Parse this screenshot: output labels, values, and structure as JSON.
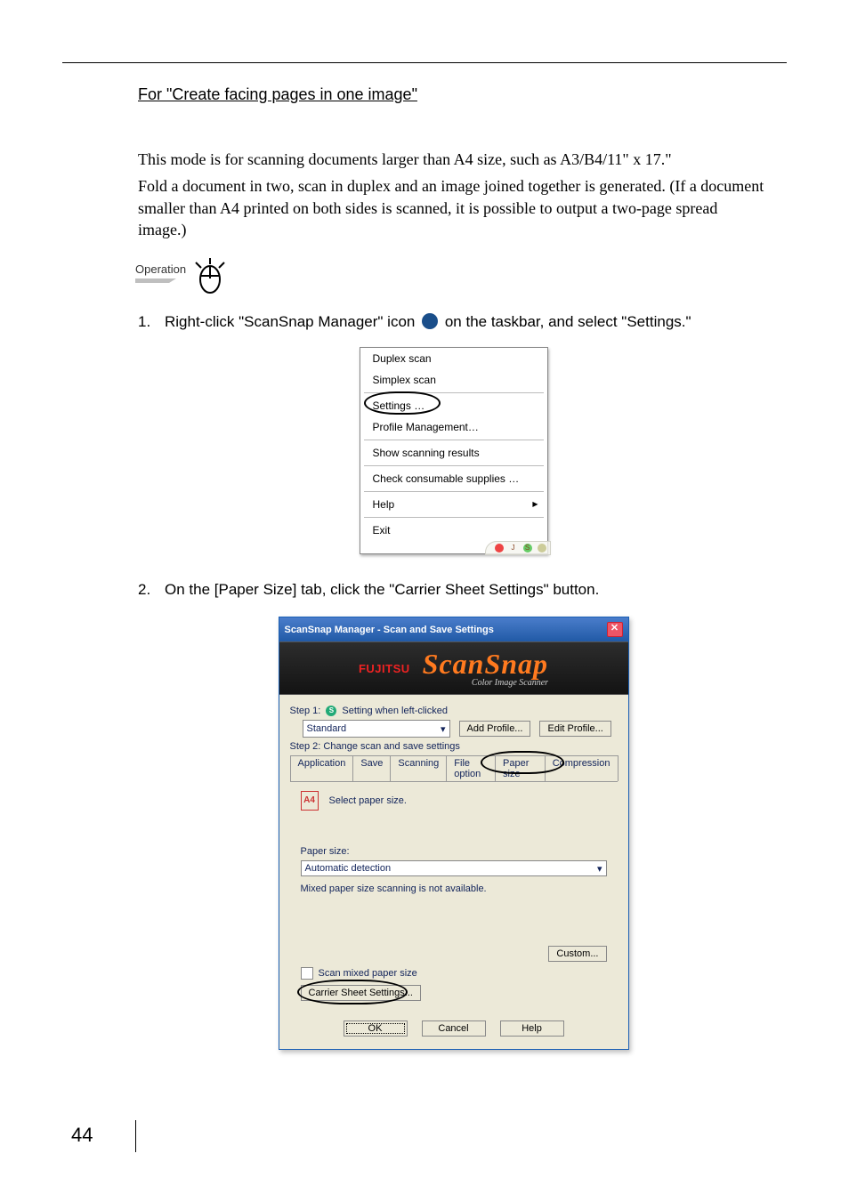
{
  "section_title": "For \"Create facing pages in one image\"",
  "paragraphs": [
    "This mode is for scanning documents larger than A4 size, such as A3/B4/11\" x 17.\"",
    "Fold a document in two, scan in duplex and an image joined together is generated. (If a document smaller than A4 printed on both sides is scanned, it is possible to output a two-page spread image.)"
  ],
  "operation_label": "Operation",
  "steps": {
    "one": {
      "num": "1.",
      "pre": "Right-click \"ScanSnap Manager\" icon",
      "post": " on the taskbar, and select \"Settings.\""
    },
    "two": {
      "num": "2.",
      "text": "On the [Paper Size] tab, click the \"Carrier Sheet Settings\" button."
    }
  },
  "context_menu": {
    "items": [
      "Duplex scan",
      "Simplex scan",
      "Settings …",
      "Profile Management…",
      "Show scanning results",
      "Check consumable supplies …",
      "Help",
      "Exit"
    ]
  },
  "dialog": {
    "title": "ScanSnap Manager - Scan and Save Settings",
    "brand_fujitsu": "FUJITSU",
    "brand_main": "ScanSnap",
    "brand_sub": "Color Image Scanner",
    "step1_label": "Step 1:",
    "step1_text": "Setting when left-clicked",
    "profile_value": "Standard",
    "add_profile": "Add Profile...",
    "edit_profile": "Edit Profile...",
    "step2_text": "Step 2: Change scan and save settings",
    "tabs": [
      "Application",
      "Save",
      "Scanning",
      "File option",
      "Paper size",
      "Compression"
    ],
    "select_label": "Select paper size.",
    "paper_size_label": "Paper size:",
    "paper_size_value": "Automatic detection",
    "mixed_note": "Mixed paper size scanning is not available.",
    "custom_btn": "Custom...",
    "scan_mixed": "Scan mixed paper size",
    "carrier_btn": "Carrier Sheet Settings...",
    "ok": "OK",
    "cancel": "Cancel",
    "help": "Help"
  },
  "page_number": "44"
}
